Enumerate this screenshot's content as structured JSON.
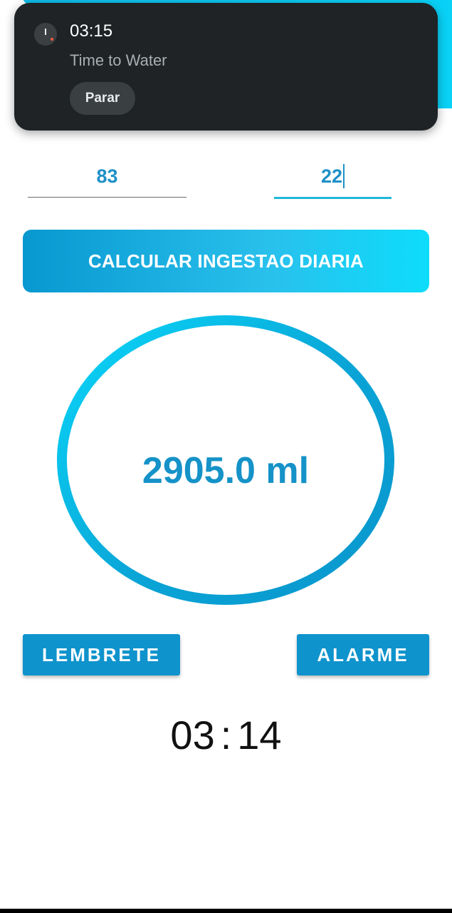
{
  "notification": {
    "time": "03:15",
    "text": "Time to Water",
    "action_label": "Parar",
    "icon": "timer-icon"
  },
  "header": {
    "refresh_icon": "refresh-icon"
  },
  "form": {
    "weight_value": "83",
    "age_value": "22"
  },
  "calculate_button": {
    "label": "CALCULAR INGESTAO DIARIA"
  },
  "result": {
    "value": "2905.0 ml"
  },
  "actions": {
    "reminder_label": "LEMBRETE",
    "alarm_label": "ALARME"
  },
  "timer": {
    "hours": "03",
    "separator": ":",
    "minutes": "14"
  },
  "colors": {
    "accent": "#0f93cc",
    "accent_light": "#0edcfb",
    "text_blue": "#1592c8",
    "notification_bg": "#1f2326"
  }
}
